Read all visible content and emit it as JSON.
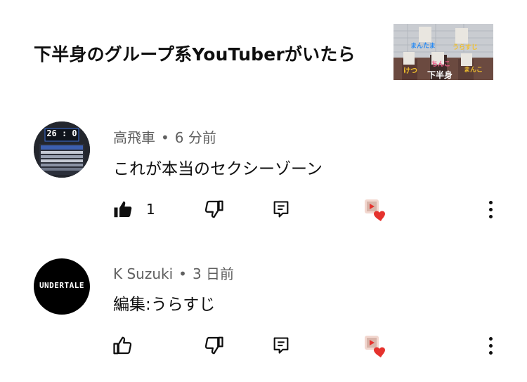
{
  "video": {
    "title": "下半身のグループ系YouTuberがいたら",
    "thumbnail": {
      "labels": [
        "まんたま",
        "うらすじ",
        "けつ",
        "ちんこ",
        "まんこ",
        "下半身"
      ]
    }
  },
  "comments": [
    {
      "author": "高飛車",
      "separator": "•",
      "time": "6 分前",
      "text": "これが本当のセクシーゾーン",
      "like_count": "1",
      "liked": true,
      "avatar": {
        "type": "scoreboard",
        "score": "26 : 0"
      }
    },
    {
      "author": "K Suzuki",
      "separator": "•",
      "time": "3 日前",
      "text": "編集:うらすじ",
      "like_count": "",
      "liked": false,
      "avatar": {
        "type": "logo",
        "logo_text": "UNDERTALE"
      }
    }
  ],
  "icons": {
    "like": "thumbs-up-icon",
    "dislike": "thumbs-down-icon",
    "reply": "reply-comment-icon",
    "creator_heart": "creator-heart-icon",
    "more": "more-vertical-icon"
  },
  "colors": {
    "heart": "#e5322d",
    "secondary_text": "#606060"
  }
}
